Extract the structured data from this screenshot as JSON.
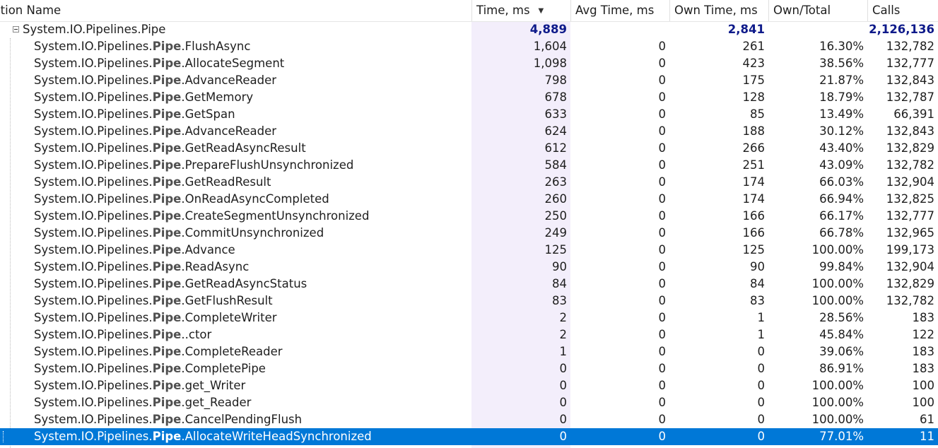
{
  "header": {
    "columns": [
      "ıction Name",
      "Time, ms",
      "Avg Time, ms",
      "Own Time, ms",
      "Own/Total",
      "Calls"
    ],
    "sort_icon": "sort-descending-icon"
  },
  "colors": {
    "accent": "#0078d7",
    "time_column_bg": "#f3eefb",
    "parent_values": "#0e1a8a"
  },
  "parent": {
    "name": "System.IO.Pipelines.Pipe",
    "time": "4,889",
    "avg": "",
    "own": "2,841",
    "pct": "",
    "calls": "2,126,136"
  },
  "prefix": "System.IO.Pipelines.",
  "class_name": "Pipe",
  "rows": [
    {
      "method": ".FlushAsync",
      "time": "1,604",
      "avg": "0",
      "own": "261",
      "pct": "16.30%",
      "calls": "132,782"
    },
    {
      "method": ".AllocateSegment",
      "time": "1,098",
      "avg": "0",
      "own": "423",
      "pct": "38.56%",
      "calls": "132,777"
    },
    {
      "method": ".AdvanceReader",
      "time": "798",
      "avg": "0",
      "own": "175",
      "pct": "21.87%",
      "calls": "132,843"
    },
    {
      "method": ".GetMemory",
      "time": "678",
      "avg": "0",
      "own": "128",
      "pct": "18.79%",
      "calls": "132,787"
    },
    {
      "method": ".GetSpan",
      "time": "633",
      "avg": "0",
      "own": "85",
      "pct": "13.49%",
      "calls": "66,391"
    },
    {
      "method": ".AdvanceReader",
      "time": "624",
      "avg": "0",
      "own": "188",
      "pct": "30.12%",
      "calls": "132,843"
    },
    {
      "method": ".GetReadAsyncResult",
      "time": "612",
      "avg": "0",
      "own": "266",
      "pct": "43.40%",
      "calls": "132,829"
    },
    {
      "method": ".PrepareFlushUnsynchronized",
      "time": "584",
      "avg": "0",
      "own": "251",
      "pct": "43.09%",
      "calls": "132,782"
    },
    {
      "method": ".GetReadResult",
      "time": "263",
      "avg": "0",
      "own": "174",
      "pct": "66.03%",
      "calls": "132,904"
    },
    {
      "method": ".OnReadAsyncCompleted",
      "time": "260",
      "avg": "0",
      "own": "174",
      "pct": "66.94%",
      "calls": "132,825"
    },
    {
      "method": ".CreateSegmentUnsynchronized",
      "time": "250",
      "avg": "0",
      "own": "166",
      "pct": "66.17%",
      "calls": "132,777"
    },
    {
      "method": ".CommitUnsynchronized",
      "time": "249",
      "avg": "0",
      "own": "166",
      "pct": "66.78%",
      "calls": "132,965"
    },
    {
      "method": ".Advance",
      "time": "125",
      "avg": "0",
      "own": "125",
      "pct": "100.00%",
      "calls": "199,173"
    },
    {
      "method": ".ReadAsync",
      "time": "90",
      "avg": "0",
      "own": "90",
      "pct": "99.84%",
      "calls": "132,904"
    },
    {
      "method": ".GetReadAsyncStatus",
      "time": "84",
      "avg": "0",
      "own": "84",
      "pct": "100.00%",
      "calls": "132,829"
    },
    {
      "method": ".GetFlushResult",
      "time": "83",
      "avg": "0",
      "own": "83",
      "pct": "100.00%",
      "calls": "132,782"
    },
    {
      "method": ".CompleteWriter",
      "time": "2",
      "avg": "0",
      "own": "1",
      "pct": "28.56%",
      "calls": "183"
    },
    {
      "method": "..ctor",
      "time": "2",
      "avg": "0",
      "own": "1",
      "pct": "45.84%",
      "calls": "122"
    },
    {
      "method": ".CompleteReader",
      "time": "1",
      "avg": "0",
      "own": "0",
      "pct": "39.06%",
      "calls": "183"
    },
    {
      "method": ".CompletePipe",
      "time": "0",
      "avg": "0",
      "own": "0",
      "pct": "86.91%",
      "calls": "183"
    },
    {
      "method": ".get_Writer",
      "time": "0",
      "avg": "0",
      "own": "0",
      "pct": "100.00%",
      "calls": "100"
    },
    {
      "method": ".get_Reader",
      "time": "0",
      "avg": "0",
      "own": "0",
      "pct": "100.00%",
      "calls": "100"
    },
    {
      "method": ".CancelPendingFlush",
      "time": "0",
      "avg": "0",
      "own": "0",
      "pct": "100.00%",
      "calls": "61"
    },
    {
      "method": ".AllocateWriteHeadSynchronized",
      "time": "0",
      "avg": "0",
      "own": "0",
      "pct": "77.01%",
      "calls": "11",
      "selected": true
    }
  ]
}
